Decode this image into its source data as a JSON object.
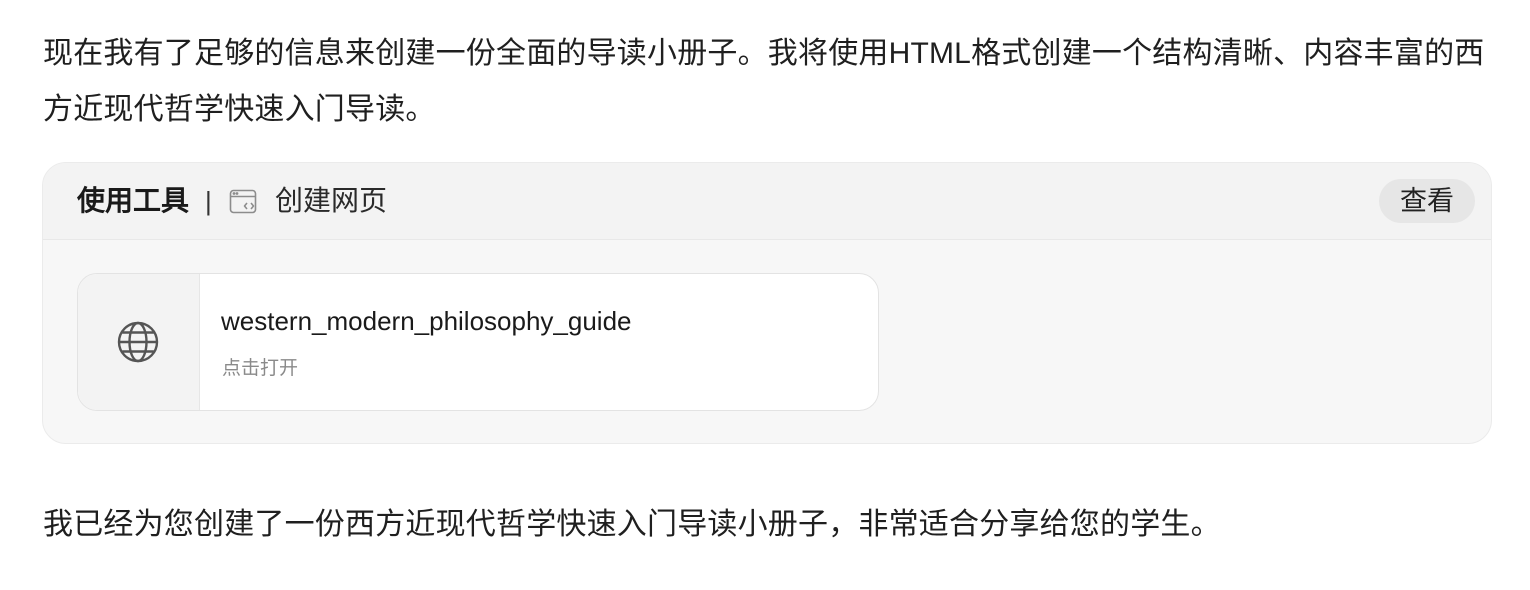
{
  "message": {
    "intro_text": "现在我有了足够的信息来创建一份全面的导读小册子。我将使用HTML格式创建一个结构清晰、内容丰富的西方近现代哲学快速入门导读。",
    "outro_text": "我已经为您创建了一份西方近现代哲学快速入门导读小册子，非常适合分享给您的学生。"
  },
  "tool_card": {
    "label": "使用工具",
    "separator": "|",
    "tool_icon": "webpage-icon",
    "tool_name": "创建网页",
    "view_button_label": "查看",
    "file": {
      "icon": "globe-icon",
      "title": "western_modern_philosophy_guide",
      "subtitle": "点击打开"
    }
  },
  "colors": {
    "text": "#1f1f1f",
    "card_bg": "#f7f7f7",
    "header_bg": "#f3f3f3",
    "button_bg": "#e6e6e6",
    "muted_text": "#8a8a8a"
  }
}
